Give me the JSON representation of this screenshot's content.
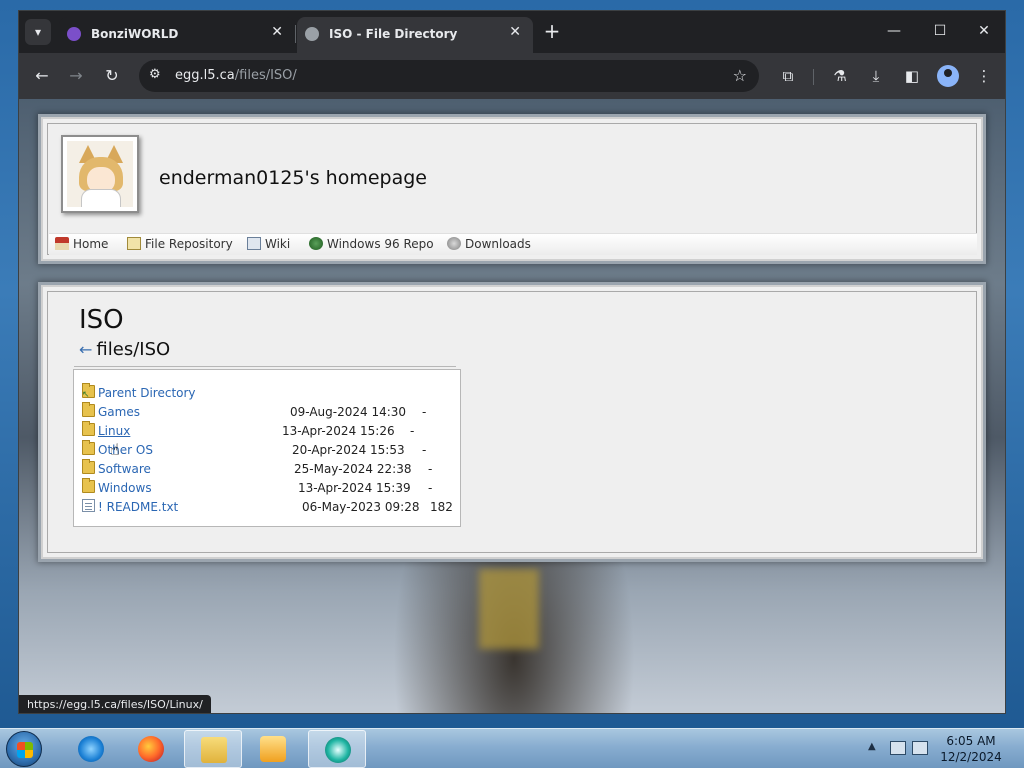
{
  "browser": {
    "tabs": [
      {
        "title": "BonziWORLD",
        "close": "✕",
        "active": false
      },
      {
        "title": "ISO - File Directory",
        "close": "✕",
        "active": true
      }
    ],
    "new_tab": "+",
    "window_controls": {
      "minimize": "—",
      "maximize": "☐",
      "close": "✕"
    },
    "address": {
      "host": "egg.l5.ca",
      "path": "/files/ISO/"
    },
    "status_url": "https://egg.l5.ca/files/ISO/Linux/"
  },
  "site": {
    "title": "enderman0125's homepage",
    "nav": [
      {
        "label": "Home",
        "icon": "house-icon"
      },
      {
        "label": "File Repository",
        "icon": "file-icon"
      },
      {
        "label": "Wiki",
        "icon": "book-icon"
      },
      {
        "label": "Windows 96 Repo",
        "icon": "globe-icon"
      },
      {
        "label": "Downloads",
        "icon": "download-icon"
      }
    ]
  },
  "directory": {
    "heading": "ISO",
    "back_arrow": "←",
    "path": "files/ISO",
    "rows": [
      {
        "name": "Parent Directory",
        "date": "",
        "size": "",
        "type": "parent"
      },
      {
        "name": "Games",
        "date": "09-Aug-2024 14:30",
        "size": "-",
        "type": "folder"
      },
      {
        "name": "Linux",
        "date": "13-Apr-2024 15:26",
        "size": "-",
        "type": "folder"
      },
      {
        "name": "Other OS",
        "date": "20-Apr-2024 15:53",
        "size": "-",
        "type": "folder"
      },
      {
        "name": "Software",
        "date": "25-May-2024 22:38",
        "size": "-",
        "type": "folder"
      },
      {
        "name": "Windows",
        "date": "13-Apr-2024 15:39",
        "size": "-",
        "type": "folder"
      },
      {
        "name": "! README.txt",
        "date": "06-May-2023 09:28",
        "size": "182",
        "type": "file"
      }
    ]
  },
  "taskbar": {
    "clock_time": "6:05 AM",
    "clock_date": "12/2/2024",
    "apps": [
      "ie-icon",
      "firefox-icon",
      "file-explorer-icon",
      "media-player-icon",
      "browser-icon"
    ]
  },
  "colors": {
    "link": "#2a66b3",
    "chrome_dark": "#202124",
    "chrome_toolbar": "#35363a"
  }
}
